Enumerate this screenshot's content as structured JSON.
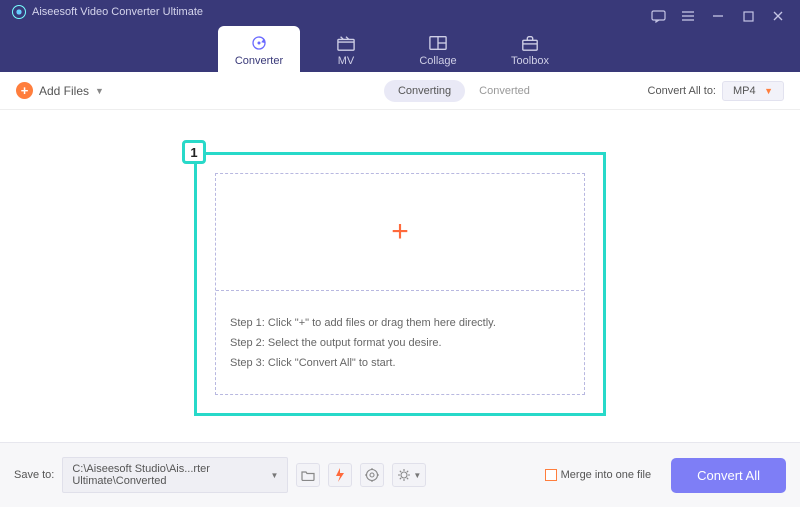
{
  "app_title": "Aiseesoft Video Converter Ultimate",
  "tabs": [
    {
      "label": "Converter"
    },
    {
      "label": "MV"
    },
    {
      "label": "Collage"
    },
    {
      "label": "Toolbox"
    }
  ],
  "toolbar": {
    "add_files": "Add Files",
    "converting": "Converting",
    "converted": "Converted",
    "convert_all_to_label": "Convert All to:",
    "format": "MP4"
  },
  "callout_number": "1",
  "steps": {
    "s1": "Step 1: Click \"+\" to add files or drag them here directly.",
    "s2": "Step 2: Select the output format you desire.",
    "s3": "Step 3: Click \"Convert All\" to start."
  },
  "footer": {
    "save_to_label": "Save to:",
    "path": "C:\\Aiseesoft Studio\\Ais...rter Ultimate\\Converted",
    "merge_label": "Merge into one file",
    "convert_all": "Convert All"
  }
}
